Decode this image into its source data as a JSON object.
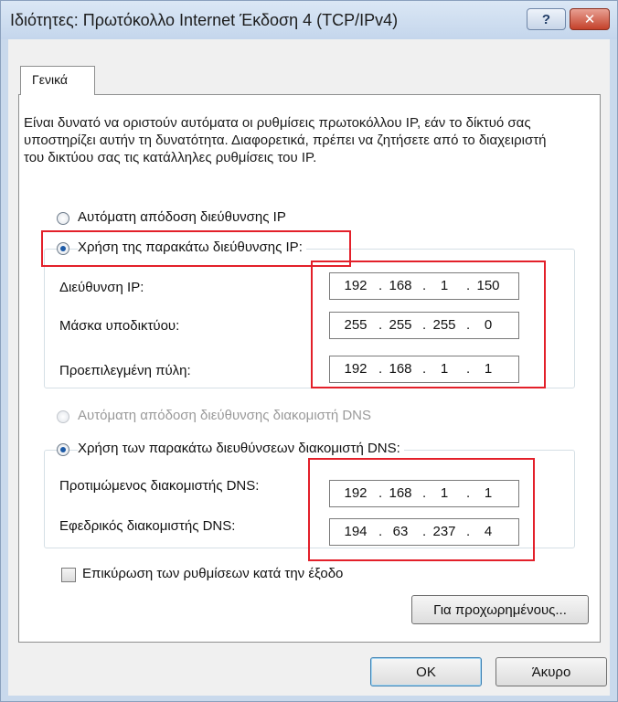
{
  "window": {
    "title": "Ιδιότητες: Πρωτόκολλο Internet Έκδοση 4 (TCP/IPv4)",
    "help_label": "?",
    "close_label": "✕"
  },
  "tabs": [
    {
      "label": "Γενικά",
      "selected": true
    }
  ],
  "description": "Είναι δυνατό να οριστούν αυτόματα οι ρυθμίσεις πρωτοκόλλου IP, εάν το δίκτυό σας υποστηρίζει αυτήν τη δυνατότητα. Διαφορετικά, πρέπει να ζητήσετε από το διαχειριστή του δικτύου σας τις κατάλληλες ρυθμίσεις του IP.",
  "ip_section": {
    "auto_label": "Αυτόματη απόδοση διεύθυνσης IP",
    "manual_label": "Χρήση της παρακάτω διεύθυνσης IP:",
    "selected": "manual",
    "fields": [
      {
        "label": "Διεύθυνση IP:",
        "octets": [
          "192",
          "168",
          "1",
          "150"
        ]
      },
      {
        "label": "Μάσκα υποδικτύου:",
        "octets": [
          "255",
          "255",
          "255",
          "0"
        ]
      },
      {
        "label": "Προεπιλεγμένη πύλη:",
        "octets": [
          "192",
          "168",
          "1",
          "1"
        ]
      }
    ]
  },
  "dns_section": {
    "auto_label": "Αυτόματη απόδοση διεύθυνσης διακομιστή DNS",
    "manual_label": "Χρήση των παρακάτω διευθύνσεων διακομιστή DNS:",
    "selected": "manual",
    "fields": [
      {
        "label": "Προτιμώμενος διακομιστής DNS:",
        "octets": [
          "192",
          "168",
          "1",
          "1"
        ]
      },
      {
        "label": "Εφεδρικός διακομιστής DNS:",
        "octets": [
          "194",
          "63",
          "237",
          "4"
        ]
      }
    ]
  },
  "validate_checkbox": {
    "label": "Επικύρωση των ρυθμίσεων κατά την έξοδο",
    "checked": false
  },
  "buttons": {
    "advanced": "Για προχωρημένους...",
    "ok": "OK",
    "cancel": "Άκυρο"
  },
  "colors": {
    "highlight": "#e3202a",
    "radio_dot": "#1d5aa6"
  }
}
